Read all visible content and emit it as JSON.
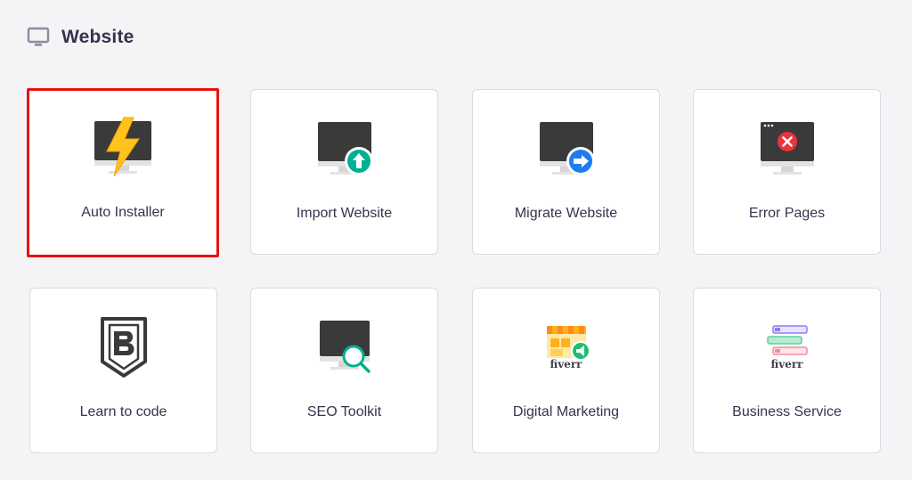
{
  "section": {
    "title": "Website",
    "icon": "monitor-icon"
  },
  "cards": [
    {
      "label": "Auto Installer",
      "icon": "lightning-monitor-icon"
    },
    {
      "label": "Import Website",
      "icon": "monitor-upload-icon"
    },
    {
      "label": "Migrate Website",
      "icon": "monitor-arrow-right-icon"
    },
    {
      "label": "Error Pages",
      "icon": "monitor-error-icon"
    },
    {
      "label": "Learn to code",
      "icon": "shield-b-icon"
    },
    {
      "label": "SEO Toolkit",
      "icon": "monitor-search-icon"
    },
    {
      "label": "Digital Marketing",
      "icon": "fiverr-store-icon"
    },
    {
      "label": "Business Service",
      "icon": "fiverr-list-icon"
    }
  ],
  "branding": {
    "fiverr_text": "fiverr"
  },
  "colors": {
    "accent_highlight": "#e8110f",
    "green": "#00b090",
    "blue": "#1d7cf2",
    "error_red": "#e8343a",
    "monitor_dark": "#3a3a3a",
    "bolt_yellow": "#ffc31e"
  }
}
